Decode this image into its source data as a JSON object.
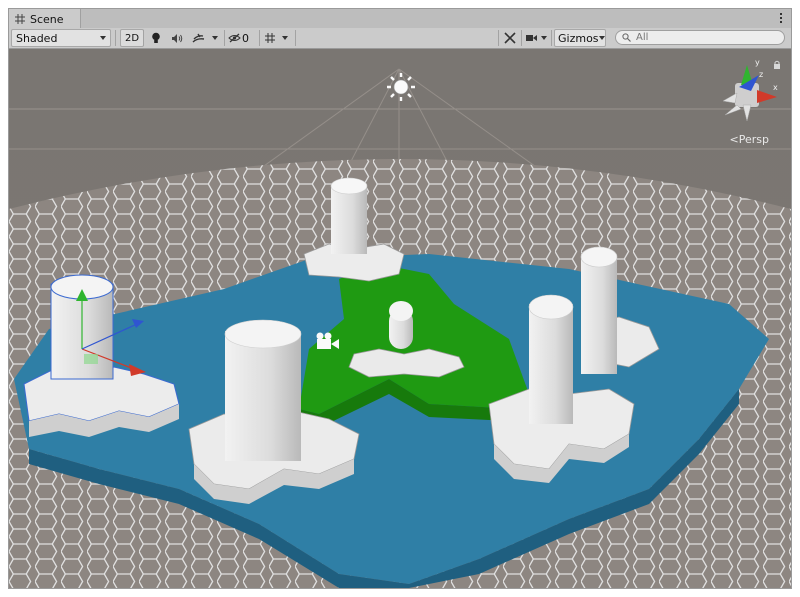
{
  "tab": {
    "title": "Scene",
    "icon": "grid-icon"
  },
  "toolbar": {
    "shading_mode": "Shaded",
    "mode_2d": "2D",
    "hidden_count": "0",
    "gizmos_label": "Gizmos",
    "search_placeholder": "All"
  },
  "viewport": {
    "projection_label": "Persp"
  },
  "colors": {
    "water": "#2e7ea5",
    "grass": "#1f9a12",
    "stone": "#e6e6e6",
    "ground": "#8c8580",
    "selection": "#3b6ad1"
  }
}
